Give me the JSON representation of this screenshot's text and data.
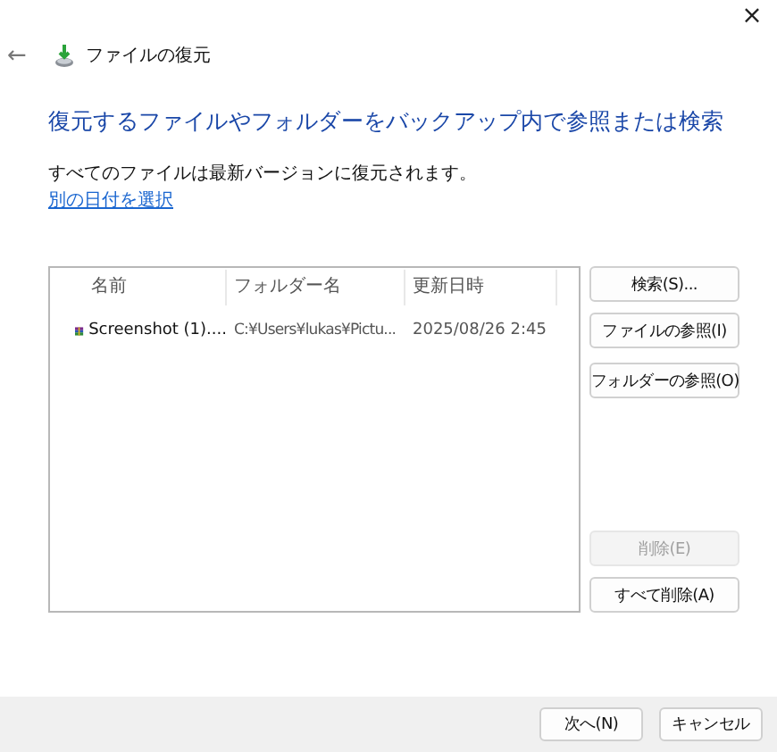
{
  "window": {
    "title": "ファイルの復元",
    "close": "×",
    "back": "←"
  },
  "heading": "復元するファイルやフォルダーをバックアップ内で参照または検索",
  "info": "すべてのファイルは最新バージョンに復元されます。",
  "link": "別の日付を選択",
  "table": {
    "columns": [
      "名前",
      "フォルダー名",
      "更新日時"
    ],
    "rows": [
      {
        "name": "Screenshot (1)....",
        "folder": "C:¥Users¥lukas¥Pictu...",
        "modified": "2025/08/26 2:45"
      }
    ]
  },
  "side_buttons": [
    {
      "label": "検索(S)...",
      "disabled": false
    },
    {
      "label": "ファイルの参照(I)",
      "disabled": false
    },
    {
      "label": "フォルダーの参照(O)",
      "disabled": false
    }
  ],
  "list_buttons": [
    {
      "label": "削除(E)",
      "disabled": true
    },
    {
      "label": "すべて削除(A)",
      "disabled": false
    }
  ],
  "footer_buttons": [
    "次へ(N)",
    "キャンセル"
  ]
}
